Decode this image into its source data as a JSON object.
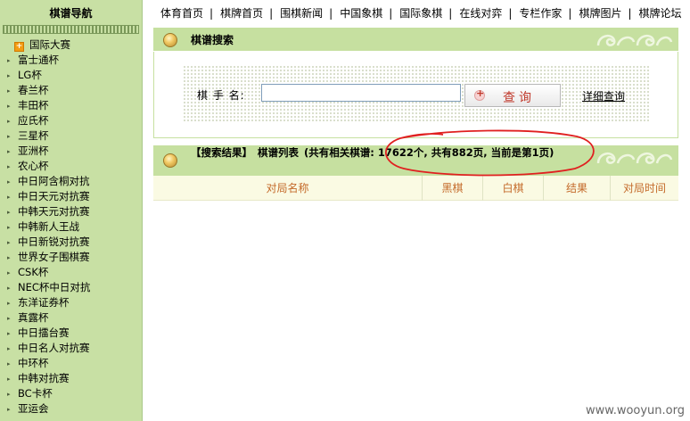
{
  "sidebar": {
    "title": "棋谱导航",
    "items": [
      {
        "label": "国际大赛",
        "open": true
      },
      {
        "label": "富士通杯"
      },
      {
        "label": "LG杯"
      },
      {
        "label": "春兰杯"
      },
      {
        "label": "丰田杯"
      },
      {
        "label": "应氏杯"
      },
      {
        "label": "三星杯"
      },
      {
        "label": "亚洲杯"
      },
      {
        "label": "农心杯"
      },
      {
        "label": "中日阿含桐对抗"
      },
      {
        "label": "中日天元对抗赛"
      },
      {
        "label": "中韩天元对抗赛"
      },
      {
        "label": "中韩新人王战"
      },
      {
        "label": "中日新锐对抗赛"
      },
      {
        "label": "世界女子围棋赛"
      },
      {
        "label": "CSK杯"
      },
      {
        "label": "NEC杯中日对抗"
      },
      {
        "label": "东洋证券杯"
      },
      {
        "label": "真露杯"
      },
      {
        "label": "中日擂台赛"
      },
      {
        "label": "中日名人对抗赛"
      },
      {
        "label": "中环杯"
      },
      {
        "label": "中韩对抗赛"
      },
      {
        "label": "BC卡杯"
      },
      {
        "label": "亚运会"
      }
    ]
  },
  "topnav": [
    "体育首页",
    "棋牌首页",
    "围棋新闻",
    "中国象棋",
    "国际象棋",
    "在线对弈",
    "专栏作家",
    "棋牌图片",
    "棋牌论坛"
  ],
  "search": {
    "title": "棋谱搜索",
    "label": "棋 手 名:",
    "input_value": "",
    "button_label": "查询",
    "advanced_link": "详细查询"
  },
  "results": {
    "head_tag": "【搜索结果】",
    "list_label": "棋谱列表",
    "summary": "(共有相关棋谱: 17622个, 共有882页, 当前是第1页)",
    "columns": [
      "对局名称",
      "黑棋",
      "白棋",
      "结果",
      "对局时间"
    ]
  },
  "watermark": "www.wooyun.org",
  "colors": {
    "sidebar_bg": "#c8e0a4",
    "header_bg": "#c6e0a0",
    "column_text": "#c46a2a",
    "button_text": "#c0392b",
    "annotation": "#e02020"
  }
}
